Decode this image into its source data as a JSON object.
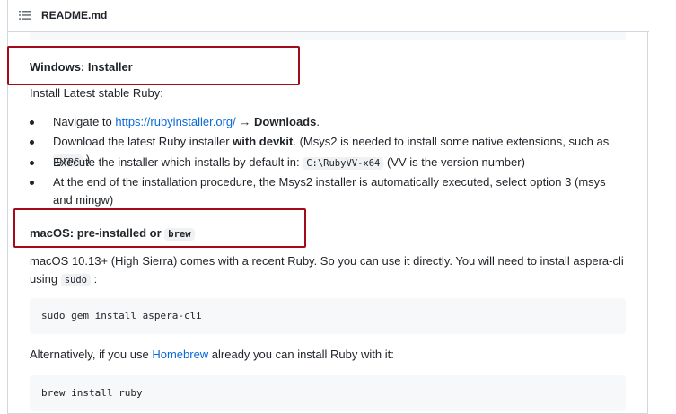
{
  "header": {
    "file_name": "README.md",
    "toc_icon": "list-icon"
  },
  "windows": {
    "heading": "Windows: Installer",
    "intro": "Install Latest stable Ruby:",
    "item1": {
      "pre": "Navigate to ",
      "link": "https://rubyinstaller.org/",
      "arrow": " → ",
      "bold": "Downloads",
      "post": "."
    },
    "item2": {
      "pre": "Download the latest Ruby installer ",
      "bold": "with devkit",
      "mid": ". (Msys2 is needed to install some native extensions, such as ",
      "code": "grpc",
      "post": " )"
    },
    "item3": {
      "pre": "Execute the installer which installs by default in: ",
      "code": "C:\\RubyVV-x64",
      "post": " (VV is the version number)"
    },
    "item4": {
      "text": "At the end of the installation procedure, the Msys2 installer is automatically executed, select option 3 (msys and mingw)"
    }
  },
  "macos": {
    "heading_text": "macOS: pre-installed or ",
    "heading_code": "brew",
    "para_pre": "macOS 10.13+ (High Sierra) comes with a recent Ruby. So you can use it directly. You will need to install aspera-cli using ",
    "para_code": "sudo",
    "para_post": " :",
    "cmd1": "sudo gem install aspera-cli",
    "alt_pre": "Alternatively, if you use ",
    "alt_link": "Homebrew",
    "alt_post": " already you can install Ruby with it:",
    "cmd2": "brew install ruby"
  },
  "colors": {
    "highlight": "#a20c1a",
    "link": "#0969da",
    "code_bg": "#f6f8fa"
  }
}
